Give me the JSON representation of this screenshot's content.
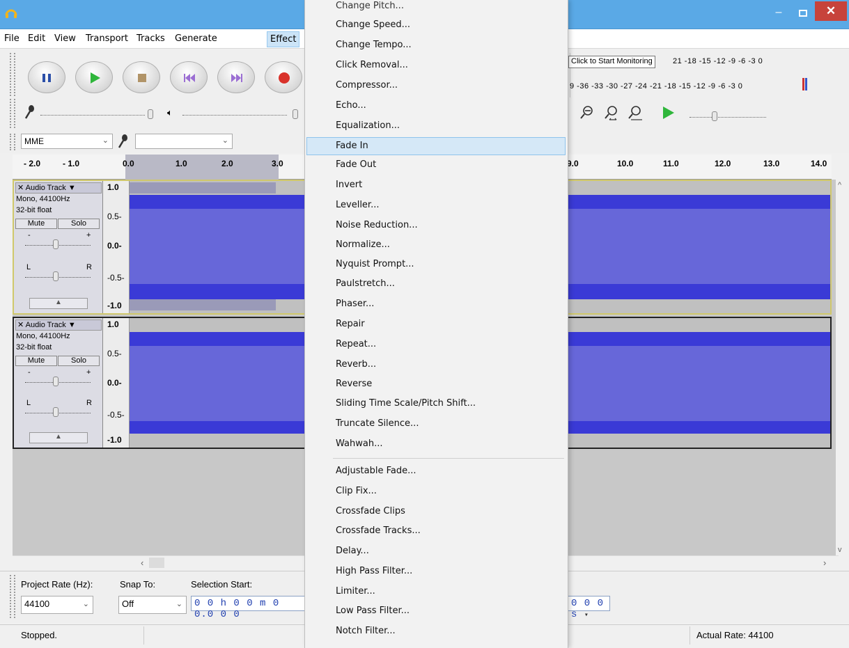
{
  "menubar": {
    "items": [
      "File",
      "Edit",
      "View",
      "Transport",
      "Tracks",
      "Generate",
      "Effect"
    ]
  },
  "device": {
    "host": "MME"
  },
  "ruler": {
    "left_labels": [
      "- 2.0",
      "- 1.0",
      "0.0",
      "1.0",
      "2.0",
      "3.0"
    ],
    "right_labels": [
      "9.0",
      "10.0",
      "11.0",
      "12.0",
      "13.0",
      "14.0"
    ]
  },
  "meters": {
    "monitor_tip": "Click to Start Monitoring",
    "rec_scale": "21 -18 -15 -12  -9  -6  -3  0",
    "play_scale": "9 -36 -33 -30 -27 -24 -21 -18 -15 -12  -9  -6  -3  0"
  },
  "tracks": [
    {
      "name": "Audio Track",
      "format": "Mono, 44100Hz",
      "bits": "32-bit float",
      "mute": "Mute",
      "solo": "Solo",
      "gain_minus": "-",
      "gain_plus": "+",
      "pan_left": "L",
      "pan_right": "R",
      "collapse": "▲",
      "scale": [
        "1.0",
        "0.5-",
        "0.0-",
        "-0.5-",
        "-1.0"
      ]
    },
    {
      "name": "Audio Track",
      "format": "Mono, 44100Hz",
      "bits": "32-bit float",
      "mute": "Mute",
      "solo": "Solo",
      "gain_minus": "-",
      "gain_plus": "+",
      "pan_left": "L",
      "pan_right": "R",
      "collapse": "▲",
      "scale": [
        "1.0",
        "0.5-",
        "0.0-",
        "-0.5-",
        "-1.0"
      ]
    }
  ],
  "selection": {
    "project_rate_label": "Project Rate (Hz):",
    "project_rate_value": "44100",
    "snap_label": "Snap To:",
    "snap_value": "Off",
    "selection_start_label": "Selection Start:",
    "selection_start_value": "0 0 h 0 0 m 0 0.0 0 0",
    "end_time_tail": "0 0 0 s"
  },
  "status": {
    "state": "Stopped.",
    "rate": "Actual Rate: 44100"
  },
  "effect_menu": {
    "partial_top": "Change Pitch...",
    "items": [
      "Change Speed...",
      "Change Tempo...",
      "Click Removal...",
      "Compressor...",
      "Echo...",
      "Equalization...",
      "Fade In",
      "Fade Out",
      "Invert",
      "Leveller...",
      "Noise Reduction...",
      "Normalize...",
      "Nyquist Prompt...",
      "Paulstretch...",
      "Phaser...",
      "Repair",
      "Repeat...",
      "Reverb...",
      "Reverse",
      "Sliding Time Scale/Pitch Shift...",
      "Truncate Silence...",
      "Wahwah..."
    ],
    "plugin_items": [
      "Adjustable Fade...",
      "Clip Fix...",
      "Crossfade Clips",
      "Crossfade Tracks...",
      "Delay...",
      "High Pass Filter...",
      "Limiter...",
      "Low Pass Filter...",
      "Notch Filter..."
    ],
    "highlighted": "Fade In"
  }
}
